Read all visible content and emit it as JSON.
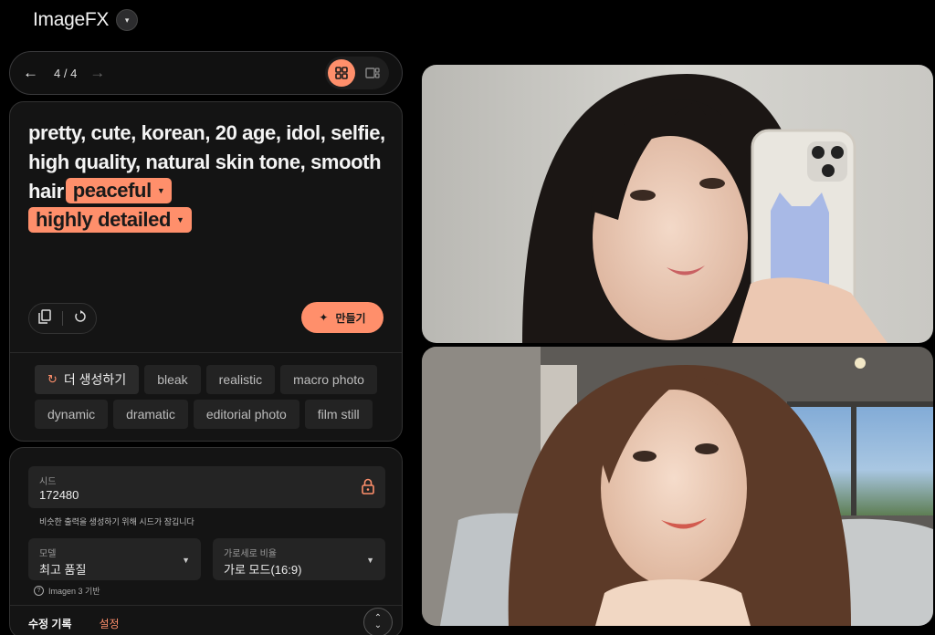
{
  "app": {
    "title": "ImageFX"
  },
  "nav": {
    "counter": "4 / 4"
  },
  "prompt": {
    "text": "pretty, cute, korean, 20 age, idol, selfie, high quality, natural skin tone, smooth hair",
    "chips": [
      "peaceful",
      "highly detailed"
    ]
  },
  "actions": {
    "make_label": "만들기"
  },
  "suggestions": {
    "refresh_label": "더 생성하기",
    "items": [
      "bleak",
      "realistic",
      "macro photo",
      "dynamic",
      "dramatic",
      "editorial photo",
      "film still"
    ]
  },
  "settings": {
    "seed": {
      "label": "시드",
      "value": "172480"
    },
    "seed_hint": "비슷한 출력을 생성하기 위해 시드가 잠깁니다",
    "model": {
      "label": "모델",
      "value": "최고 품질"
    },
    "ratio": {
      "label": "가로세로 비율",
      "value": "가로 모드(16:9)"
    },
    "model_note": "Imagen 3 기반",
    "tabs": {
      "history": "수정 기록",
      "settings": "설정"
    }
  },
  "colors": {
    "accent": "#ff8f6b",
    "background": "#000000",
    "card": "#141414"
  },
  "icons": {
    "app_dropdown": "chevron-down-icon",
    "back": "arrow-left-icon",
    "forward": "arrow-right-icon",
    "grid_view": "grid-icon",
    "single_view": "single-view-icon",
    "copy": "copy-icon",
    "reset": "reset-icon",
    "sparkle": "sparkle-icon",
    "refresh": "refresh-icon",
    "lock": "lock-icon",
    "help": "help-icon",
    "expand": "expand-icon"
  }
}
